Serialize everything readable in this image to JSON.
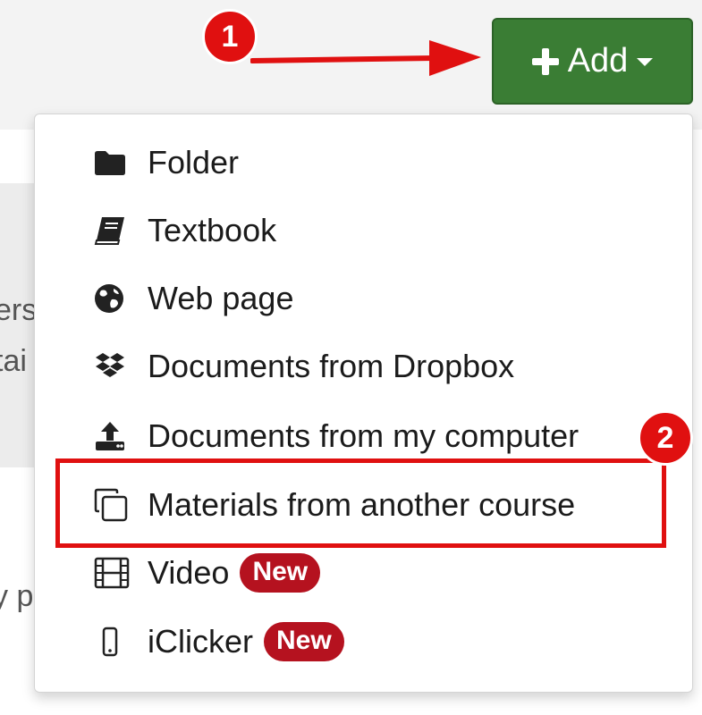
{
  "add_button": {
    "label": "Add",
    "icons": [
      "plus-icon",
      "caret-down-icon"
    ]
  },
  "annotations": {
    "step1": "1",
    "step2": "2"
  },
  "background_text": {
    "line1": "ers",
    "line2": "tai",
    "line3": "y p"
  },
  "menu": {
    "items": [
      {
        "label": "Folder",
        "icon": "folder-icon"
      },
      {
        "label": "Textbook",
        "icon": "book-icon"
      },
      {
        "label": "Web page",
        "icon": "globe-icon"
      },
      {
        "label": "Documents from Dropbox",
        "icon": "dropbox-icon"
      },
      {
        "label": "Documents from my computer",
        "icon": "upload-icon"
      },
      {
        "label": "Materials from another course",
        "icon": "copy-icon"
      },
      {
        "label": "Video",
        "icon": "film-icon",
        "badge": "New"
      },
      {
        "label": "iClicker",
        "icon": "mobile-icon",
        "badge": "New"
      }
    ]
  },
  "colors": {
    "add_button": "#3a7d34",
    "annotation_red": "#e01010",
    "new_badge": "#b5121f"
  }
}
